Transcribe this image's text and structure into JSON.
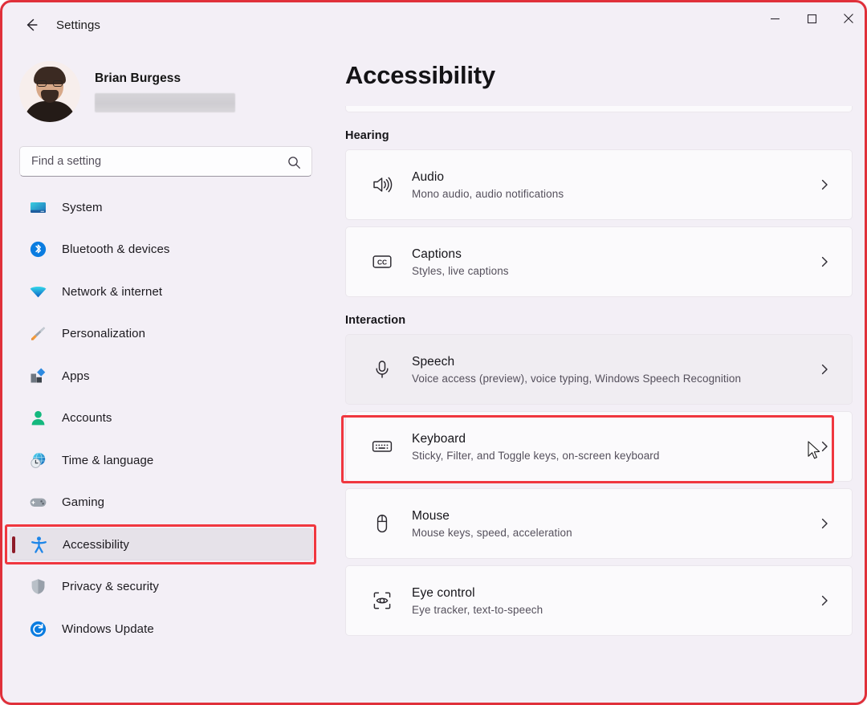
{
  "window": {
    "titlebar_title": "Settings",
    "back_icon": "back-arrow-icon",
    "minimize_label": "—",
    "maximize_label": "□",
    "close_label": "✕",
    "annotation_color": "#f0373f"
  },
  "sidebar": {
    "account": {
      "name": "Brian Burgess",
      "email_redacted": true
    },
    "search": {
      "placeholder": "Find a setting",
      "value": "",
      "icon": "search-icon"
    },
    "items": [
      {
        "label": "System",
        "icon": "monitor-icon",
        "selected": false
      },
      {
        "label": "Bluetooth & devices",
        "icon": "bluetooth-icon",
        "selected": false
      },
      {
        "label": "Network & internet",
        "icon": "wifi-icon",
        "selected": false
      },
      {
        "label": "Personalization",
        "icon": "paintbrush-icon",
        "selected": false
      },
      {
        "label": "Apps",
        "icon": "apps-icon",
        "selected": false
      },
      {
        "label": "Accounts",
        "icon": "person-icon",
        "selected": false
      },
      {
        "label": "Time & language",
        "icon": "clock-globe-icon",
        "selected": false
      },
      {
        "label": "Gaming",
        "icon": "gamepad-icon",
        "selected": false
      },
      {
        "label": "Accessibility",
        "icon": "accessibility-icon",
        "selected": true
      },
      {
        "label": "Privacy & security",
        "icon": "shield-icon",
        "selected": false
      },
      {
        "label": "Windows Update",
        "icon": "update-icon",
        "selected": false
      }
    ]
  },
  "main": {
    "page_title": "Accessibility",
    "sections": [
      {
        "heading": "Hearing",
        "cards": [
          {
            "title": "Audio",
            "subtitle": "Mono audio, audio notifications",
            "icon": "speaker-icon",
            "chevron": "chevron-right-icon",
            "highlighted": false
          },
          {
            "title": "Captions",
            "subtitle": "Styles, live captions",
            "icon": "closed-caption-icon",
            "chevron": "chevron-right-icon",
            "highlighted": false
          }
        ]
      },
      {
        "heading": "Interaction",
        "cards": [
          {
            "title": "Speech",
            "subtitle": "Voice access (preview), voice typing, Windows Speech Recognition",
            "icon": "microphone-icon",
            "chevron": "chevron-right-icon",
            "highlighted": true
          },
          {
            "title": "Keyboard",
            "subtitle": "Sticky, Filter, and Toggle keys, on-screen keyboard",
            "icon": "keyboard-icon",
            "chevron": "chevron-right-icon",
            "highlighted": false
          },
          {
            "title": "Mouse",
            "subtitle": "Mouse keys, speed, acceleration",
            "icon": "mouse-icon",
            "chevron": "chevron-right-icon",
            "highlighted": false
          },
          {
            "title": "Eye control",
            "subtitle": "Eye tracker, text-to-speech",
            "icon": "eye-control-icon",
            "chevron": "chevron-right-icon",
            "highlighted": false
          }
        ]
      }
    ]
  }
}
